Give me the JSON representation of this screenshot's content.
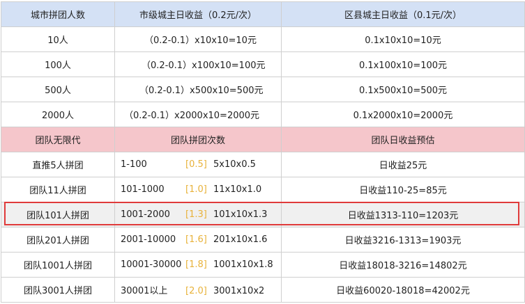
{
  "header1": [
    "城市拼团人数",
    "市级城主日收益（0.2元/次）",
    "区县城主日收益（0.1元/次）"
  ],
  "rows1": [
    {
      "people": "10人",
      "city": "（0.2-0.1）x10x10=10元",
      "county": "0.1x10x10=10元"
    },
    {
      "people": "100人",
      "city": "（0.2-0.1）x100x10=100元",
      "county": "0.1x100x10=100元"
    },
    {
      "people": "500人",
      "city": "（0.2-0.1）x500x10=500元",
      "county": "0.1x500x10=500元"
    },
    {
      "people": "2000人",
      "city": "（0.2-0.1）x2000x10=2000元",
      "county": "0.1x2000x10=2000元"
    }
  ],
  "header2": [
    "团队无限代",
    "团队拼团次数",
    "团队日收益预估"
  ],
  "rows2": [
    {
      "team": "直推5人拼团",
      "range": "1-100",
      "mult": "[0.5]",
      "calc": "5x10x0.5",
      "income": "日收益25元"
    },
    {
      "team": "团队11人拼团",
      "range": "101-1000",
      "mult": "[1.0]",
      "calc": "11x10x1.0",
      "income": "日收益110-25=85元"
    },
    {
      "team": "团队101人拼团",
      "range": "1001-2000",
      "mult": "[1.3]",
      "calc": "101x10x1.3",
      "income": "日收益1313-110=1203元"
    },
    {
      "team": "团队201人拼团",
      "range": "2001-10000",
      "mult": "[1.6]",
      "calc": "201x10x1.6",
      "income": "日收益3216-1313=1903元"
    },
    {
      "team": "团队1001人拼团",
      "range": "10001-30000",
      "mult": "[1.8]",
      "calc": "1001x10x1.8",
      "income": "日收益18018-3216=14802元"
    },
    {
      "team": "团队3001人拼团",
      "range": "30001以上",
      "mult": "[2.0]",
      "calc": "3001x10x2",
      "income": "日收益60020-18018=42002元"
    }
  ],
  "highlight_row_index": 2,
  "colors": {
    "header_blue": "#d4e1f5",
    "header_pink": "#f5c6cb",
    "multiplier": "#e8b23a",
    "highlight_border": "#e03a3a"
  }
}
